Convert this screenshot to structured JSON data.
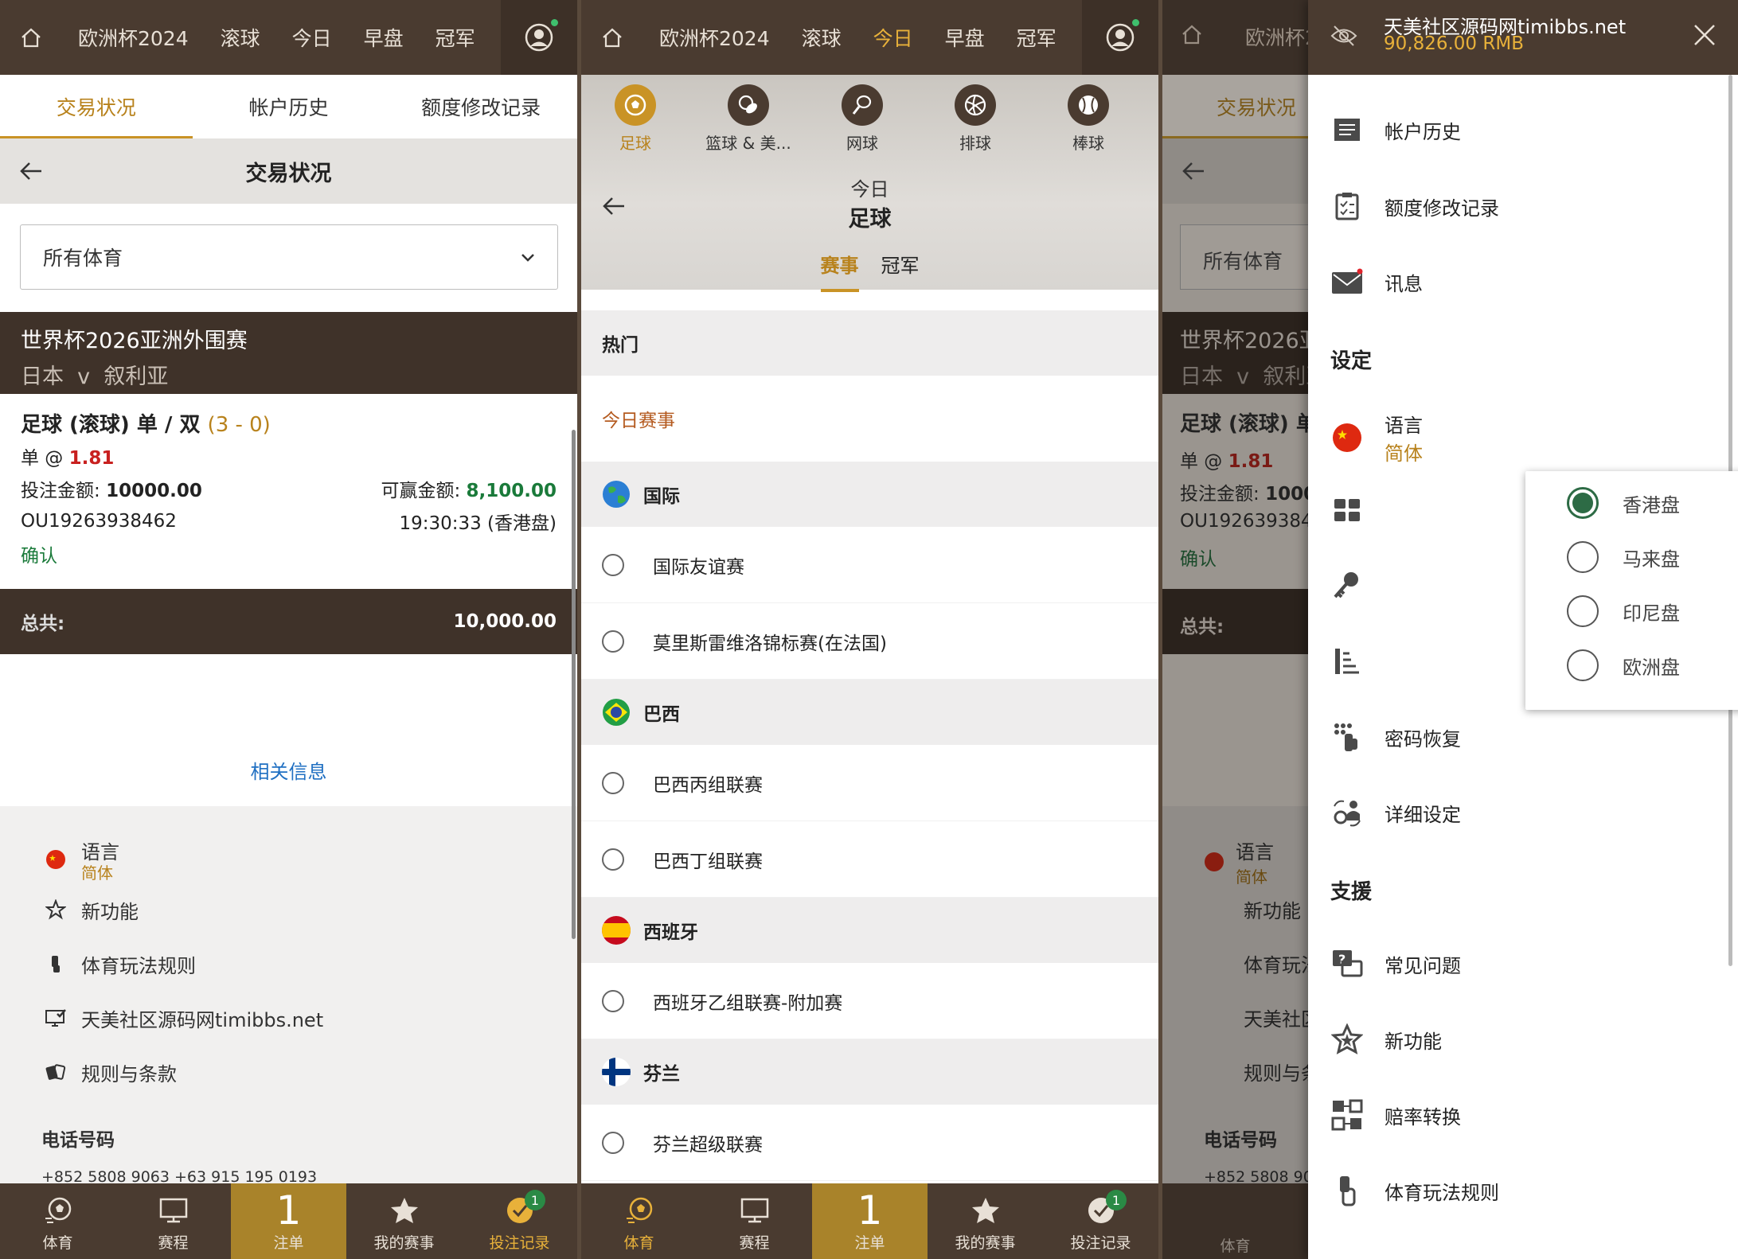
{
  "nav": {
    "tabs": [
      "欧洲杯2024",
      "滚球",
      "今日",
      "早盘",
      "冠军"
    ],
    "short_first": "欧洲杯2"
  },
  "account_tabs": [
    "交易状况",
    "帐户历史",
    "额度修改记录"
  ],
  "trade": {
    "title": "交易状况",
    "filter": "所有体育",
    "league": "世界杯2026亚洲外围赛",
    "home": "日本",
    "vs": "v",
    "away": "叙利亚",
    "market": "足球 (滚球) 单 / 双",
    "score": "(3 - 0)",
    "selection": "单 @",
    "odds": "1.81",
    "stake_label": "投注金额:",
    "stake": "10000.00",
    "win_label": "可赢金额:",
    "win": "8,100.00",
    "ticket": "OU19263938462",
    "time": "19:30:33 (香港盘)",
    "status": "确认",
    "total_label": "总共:",
    "total": "10,000.00",
    "related": "相关信息"
  },
  "footer_menu": {
    "lang_label": "语言",
    "lang_value": "简体",
    "new": "新功能",
    "rules": "体育玩法规则",
    "site": "天美社区源码网timibbs.net",
    "terms": "规则与条款",
    "phone_label": "电话号码",
    "phones": "+852 5808 9063    +63 915 195 0193"
  },
  "bottom_nav": [
    {
      "label": "体育"
    },
    {
      "label": "赛程"
    },
    {
      "label": "注单",
      "count": "1"
    },
    {
      "label": "我的赛事"
    },
    {
      "label": "投注记录",
      "badge": "1"
    }
  ],
  "sports": {
    "items": [
      "足球",
      "篮球 & 美...",
      "网球",
      "排球",
      "棒球"
    ],
    "day": "今日",
    "current": "足球",
    "subtabs": [
      "赛事",
      "冠军"
    ]
  },
  "leagues": {
    "hot": "热门",
    "today": "今日赛事",
    "groups": [
      {
        "name": "国际",
        "items": [
          "国际友谊赛",
          "莫里斯雷维洛锦标赛(在法国)"
        ]
      },
      {
        "name": "巴西",
        "items": [
          "巴西丙组联赛",
          "巴西丁组联赛"
        ]
      },
      {
        "name": "西班牙",
        "items": [
          "西班牙乙组联赛-附加赛"
        ]
      },
      {
        "name": "芬兰",
        "items": [
          "芬兰超级联赛"
        ]
      }
    ]
  },
  "drawer": {
    "user": "天美社区源码网timibbs.net",
    "balance": "90,826.00  RMB",
    "history": "帐户历史",
    "limit": "额度修改记录",
    "msg": "讯息",
    "settings": "设定",
    "lang_label": "语言",
    "lang_value": "简体",
    "odds_options": [
      "香港盘",
      "马来盘",
      "印尼盘",
      "欧洲盘"
    ],
    "pwd": "密码恢复",
    "detail": "详细设定",
    "support": "支援",
    "faq": "常见问题",
    "new": "新功能",
    "odds_conv": "赔率转换",
    "rules": "体育玩法规则"
  },
  "colors": {
    "brand_dark": "#4a3b30",
    "gold": "#c99326",
    "red": "#c8201f",
    "green": "#1a7a3a"
  }
}
